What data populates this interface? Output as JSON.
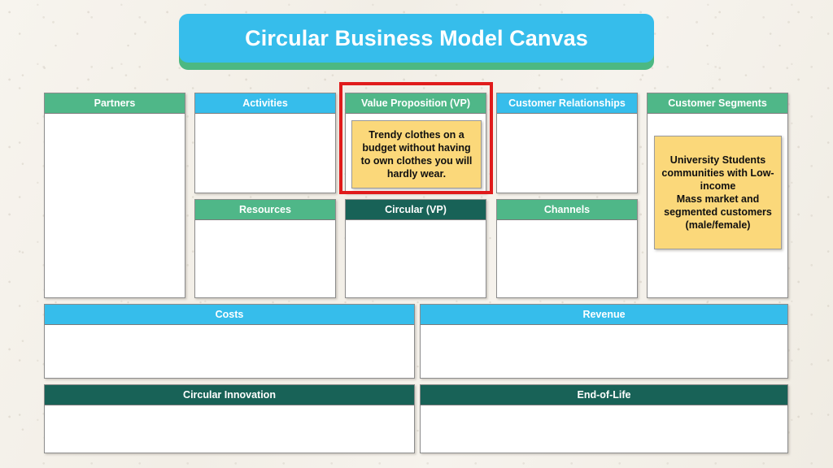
{
  "banner": {
    "title": "Circular Business Model Canvas"
  },
  "colors": {
    "background": "#f5f2ec",
    "green": "#4fb788",
    "cyan": "#36bdeb",
    "dark_teal": "#186257",
    "note_yellow": "#fbd87a",
    "highlight_red": "#e01b1b",
    "header_text": "#ffffff",
    "note_text": "#101010"
  },
  "cells": {
    "partners": {
      "title": "Partners",
      "header_color": "green",
      "content": ""
    },
    "activities": {
      "title": "Activities",
      "header_color": "cyan",
      "content": ""
    },
    "value_proposition": {
      "title": "Value Proposition (VP)",
      "header_color": "green"
    },
    "customer_relationships": {
      "title": "Customer Relationships",
      "header_color": "cyan",
      "content": ""
    },
    "customer_segments": {
      "title": "Customer Segments",
      "header_color": "green"
    },
    "resources": {
      "title": "Resources",
      "header_color": "green",
      "content": ""
    },
    "circular_vp": {
      "title": "Circular (VP)",
      "header_color": "teal",
      "content": ""
    },
    "channels": {
      "title": "Channels",
      "header_color": "green",
      "content": ""
    },
    "costs": {
      "title": "Costs",
      "header_color": "cyan",
      "content": ""
    },
    "revenue": {
      "title": "Revenue",
      "header_color": "cyan",
      "content": ""
    },
    "circular_innovation": {
      "title": "Circular Innovation",
      "header_color": "teal",
      "content": ""
    },
    "end_of_life": {
      "title": "End-of-Life",
      "header_color": "teal",
      "content": ""
    }
  },
  "notes": {
    "value_proposition_note": "Trendy clothes on a budget without having to own clothes you will hardly wear.",
    "customer_segments_note": "University Students communities with Low-income\nMass market and segmented customers (male/female)"
  }
}
